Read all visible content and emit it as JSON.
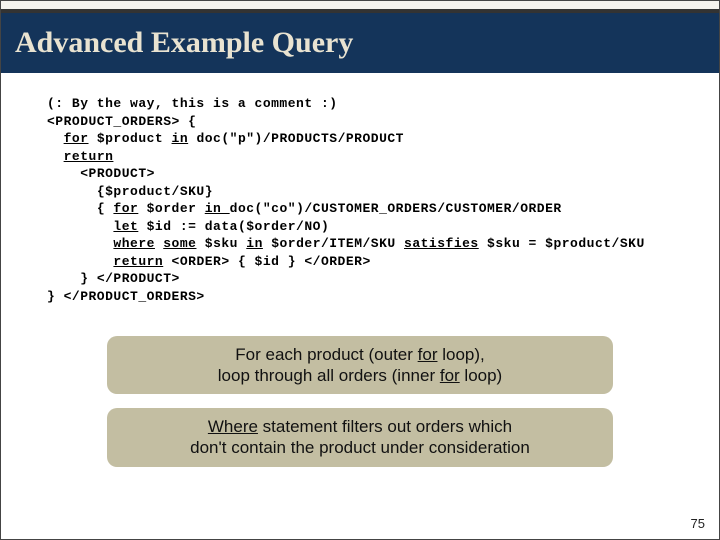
{
  "title": "Advanced Example Query",
  "code": {
    "l1": "(: By the way, this is a comment :)",
    "l2": "<PRODUCT_ORDERS> {",
    "l3_kw1": "for",
    "l3_var": " $product ",
    "l3_kw2": "in",
    "l3_rest": " doc(\"p\")/PRODUCTS/PRODUCT",
    "l4_kw": "return",
    "l5": "<PRODUCT>",
    "l6": "{$product/SKU}",
    "l7_open": "{ ",
    "l7_kw1": "for",
    "l7_mid1": " $order ",
    "l7_kw2": "in ",
    "l7_rest": "doc(\"co\")/CUSTOMER_ORDERS/CUSTOMER/ORDER",
    "l8_kw": "let",
    "l8_rest": " $id := data($order/NO)",
    "l9_kw1": "where",
    "l9_s": " ",
    "l9_kw2": "some",
    "l9_mid": " $sku ",
    "l9_kw3": "in",
    "l9_mid2": " $order/ITEM/SKU ",
    "l9_kw4": "satisfies",
    "l9_rest": " $sku = $product/SKU",
    "l10_kw": "return",
    "l10_rest": " <ORDER> { $id } </ORDER>",
    "l11": "} </PRODUCT>",
    "l12": "} </PRODUCT_ORDERS>"
  },
  "callout1": {
    "pre1": "For each product (outer ",
    "u1": "for",
    "post1": " loop),",
    "pre2": "loop through all orders (inner ",
    "u2": "for",
    "post2": " loop)"
  },
  "callout2": {
    "u": "Where",
    "line1_rest": " statement filters out orders which",
    "line2": "don't contain the product under consideration"
  },
  "page_number": "75"
}
